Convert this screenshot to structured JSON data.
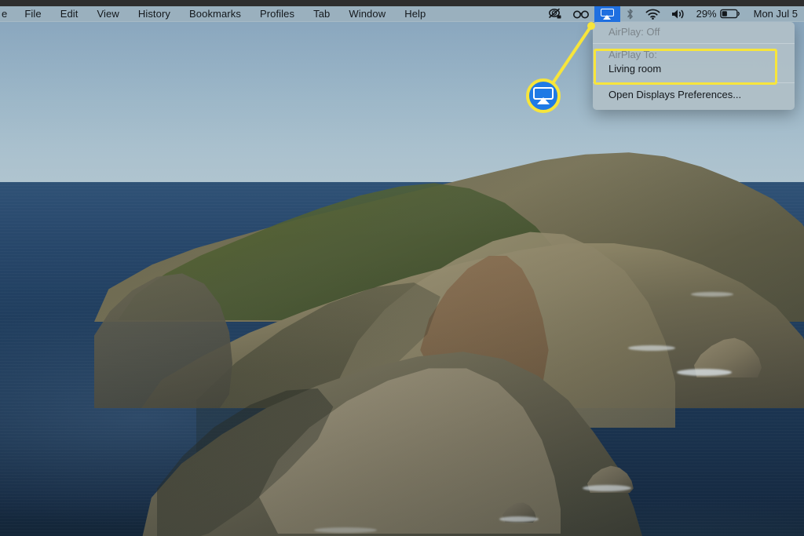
{
  "desktop": {
    "wallpaper_description": "macOS Catalina coastline — rocky island ridge above deep blue ocean",
    "colors": {
      "sky": "#9ab5c6",
      "ocean": "#234264",
      "rock": "#8a8266",
      "vegetation": "#4b5a34",
      "accent_yellow": "#f7e53b",
      "accent_blue": "#1f6fe0",
      "menubar": "#9cb2be"
    }
  },
  "menubar": {
    "apps": [
      {
        "label": "e",
        "name": "menu-app-truncated"
      },
      {
        "label": "File",
        "name": "menu-file"
      },
      {
        "label": "Edit",
        "name": "menu-edit"
      },
      {
        "label": "View",
        "name": "menu-view"
      },
      {
        "label": "History",
        "name": "menu-history"
      },
      {
        "label": "Bookmarks",
        "name": "menu-bookmarks"
      },
      {
        "label": "Profiles",
        "name": "menu-profiles"
      },
      {
        "label": "Tab",
        "name": "menu-tab"
      },
      {
        "label": "Window",
        "name": "menu-window"
      },
      {
        "label": "Help",
        "name": "menu-help"
      }
    ],
    "status": {
      "screen_sharing_icon": "screen-sharing-off-icon",
      "accessibility_icon": "glasses-icon",
      "airplay_icon": "airplay-icon",
      "bluetooth_icon": "bluetooth-icon",
      "wifi_icon": "wifi-icon",
      "volume_icon": "volume-icon",
      "battery_percent": "29%",
      "battery_icon": "battery-icon",
      "clock": "Mon Jul 5"
    }
  },
  "airplay_menu": {
    "status_label": "AirPlay: Off",
    "target_group_label": "AirPlay To:",
    "target_value": "Living room",
    "preferences_label": "Open Displays Preferences..."
  },
  "callout": {
    "icon_name": "airplay-icon",
    "highlight_color": "#f7e53b"
  }
}
